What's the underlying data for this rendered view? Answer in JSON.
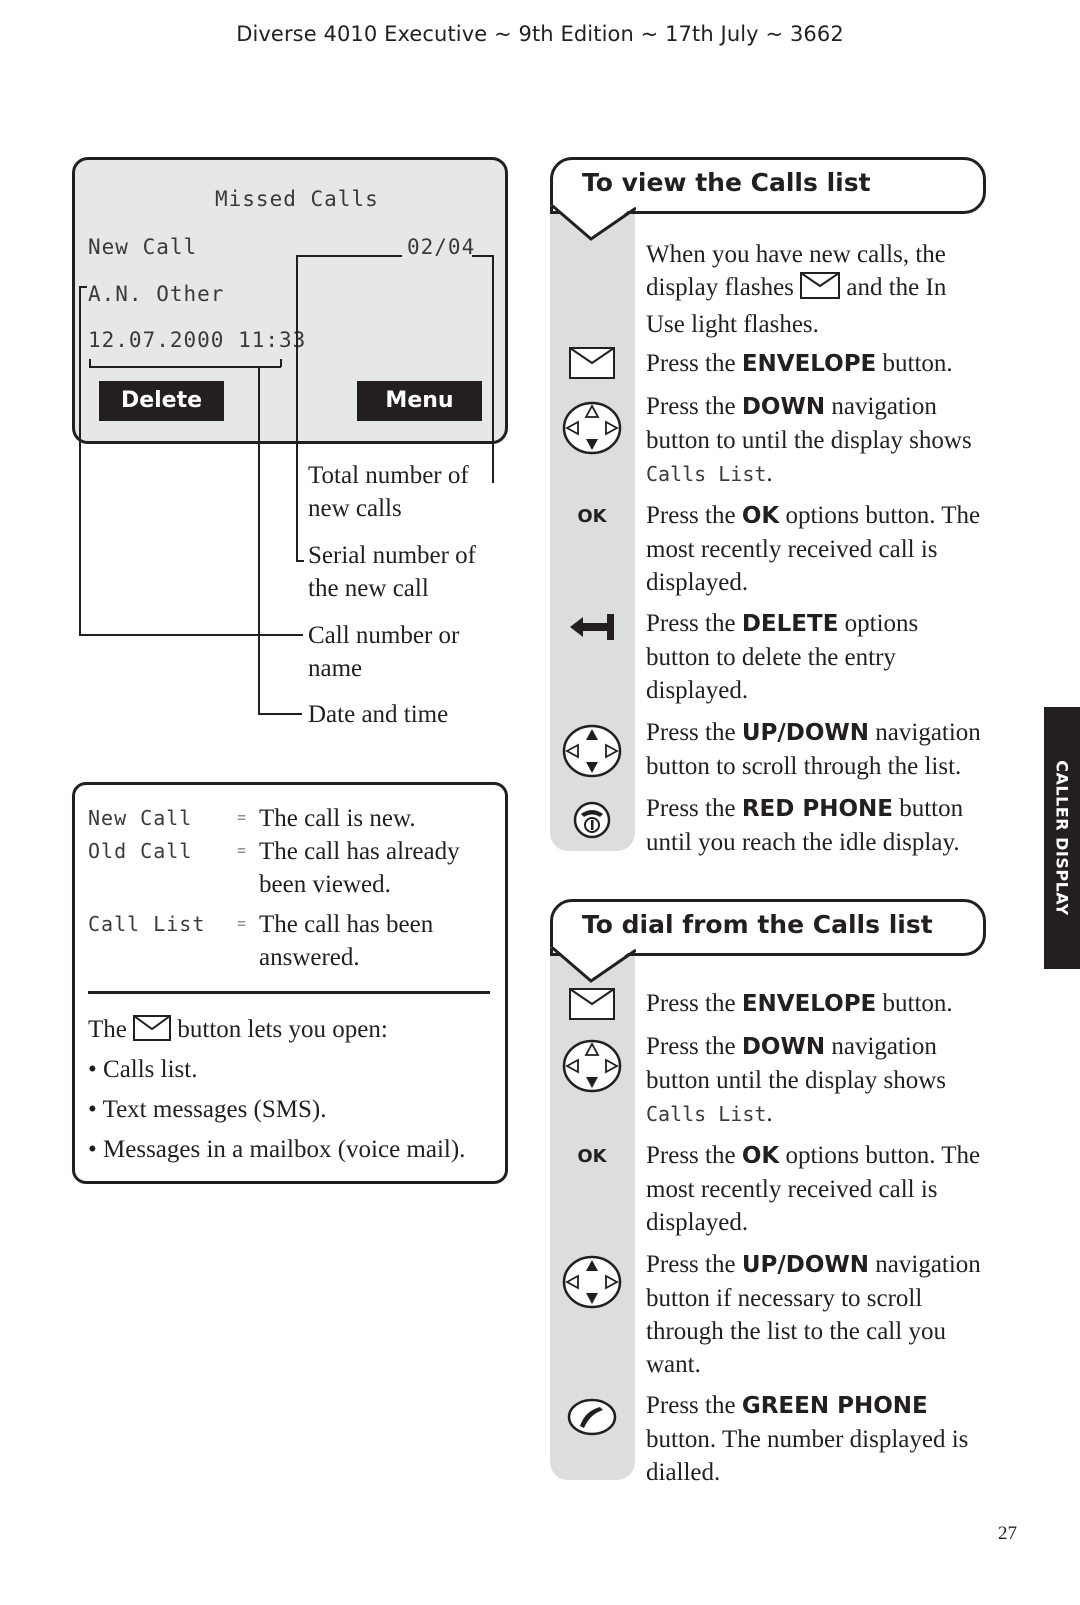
{
  "header": {
    "title": "Diverse 4010 Executive ~ 9th Edition ~ 17th July ~ 3662"
  },
  "lcd": {
    "title": "Missed Calls",
    "status": "New Call",
    "counter": "02/04",
    "caller": "A.N. Other",
    "datetime": "12.07.2000 11:33",
    "left_softkey": "Delete",
    "right_softkey": "Menu"
  },
  "callouts": [
    {
      "line1": "Total number of",
      "line2": "new calls"
    },
    {
      "line1": "Serial number of",
      "line2": "the new call"
    },
    {
      "line1": "Call number or",
      "line2": "name"
    },
    {
      "line1": "Date and time",
      "line2": ""
    }
  ],
  "legend": {
    "entries": [
      {
        "term": "New Call",
        "eq": "=",
        "line1": "The call is new.",
        "line2": ""
      },
      {
        "term": "Old Call",
        "eq": "=",
        "line1": "The call has already",
        "line2": "been viewed."
      },
      {
        "term": "Call List",
        "eq": "=",
        "line1": "The call has been",
        "line2": "answered."
      }
    ],
    "envelope_intro_before": "The",
    "envelope_intro_after": "button lets you open:",
    "envelope_icon": "envelope-icon",
    "bullets": [
      "Calls list.",
      "Text messages (SMS).",
      "Messages in a mailbox (voice mail)."
    ]
  },
  "section_view": {
    "title": "To view the Calls list",
    "intro": {
      "before": "When you have new calls, the display flashes",
      "after": "and the In Use light flashes."
    },
    "steps": [
      {
        "icon": "envelope-icon",
        "pre": "Press the ",
        "bold": "ENVELOPE",
        "post": " button."
      },
      {
        "icon": "nav-down-icon",
        "pre": "Press the ",
        "bold": "DOWN",
        "post": " navigation button to until the display shows ",
        "mono": "Calls List",
        "tail": "."
      },
      {
        "icon": "ok-icon",
        "icon_text": "OK",
        "pre": "Press the ",
        "bold": "OK",
        "post": " options button. The most recently received call is displayed."
      },
      {
        "icon": "delete-arrow-icon",
        "pre": "Press the ",
        "bold": "DELETE",
        "post": " options button to delete the entry displayed."
      },
      {
        "icon": "nav-updown-icon",
        "pre": "Press the ",
        "bold": "UP/DOWN",
        "post": " navigation button to scroll through the list."
      },
      {
        "icon": "red-phone-icon",
        "pre": "Press the ",
        "bold": "RED PHONE",
        "post": " button until you reach the idle display."
      }
    ]
  },
  "section_dial": {
    "title": "To dial from the Calls list",
    "steps": [
      {
        "icon": "envelope-icon",
        "pre": "Press the ",
        "bold": "ENVELOPE",
        "post": " button."
      },
      {
        "icon": "nav-down-icon",
        "pre": "Press the ",
        "bold": "DOWN",
        "post": " navigation button until the display shows ",
        "mono": "Calls List",
        "tail": "."
      },
      {
        "icon": "ok-icon",
        "icon_text": "OK",
        "pre": "Press the ",
        "bold": "OK",
        "post": " options button. The most recently received call is displayed."
      },
      {
        "icon": "nav-updown-icon",
        "pre": "Press the ",
        "bold": "UP/DOWN",
        "post": " navigation button if necessary to scroll through the list to the call you want."
      },
      {
        "icon": "green-phone-icon",
        "pre": "Press the ",
        "bold": "GREEN PHONE",
        "post": " button. The number displayed is dialled."
      }
    ]
  },
  "side_tab": {
    "label": "CALLER DISPLAY"
  },
  "page_number": "27"
}
